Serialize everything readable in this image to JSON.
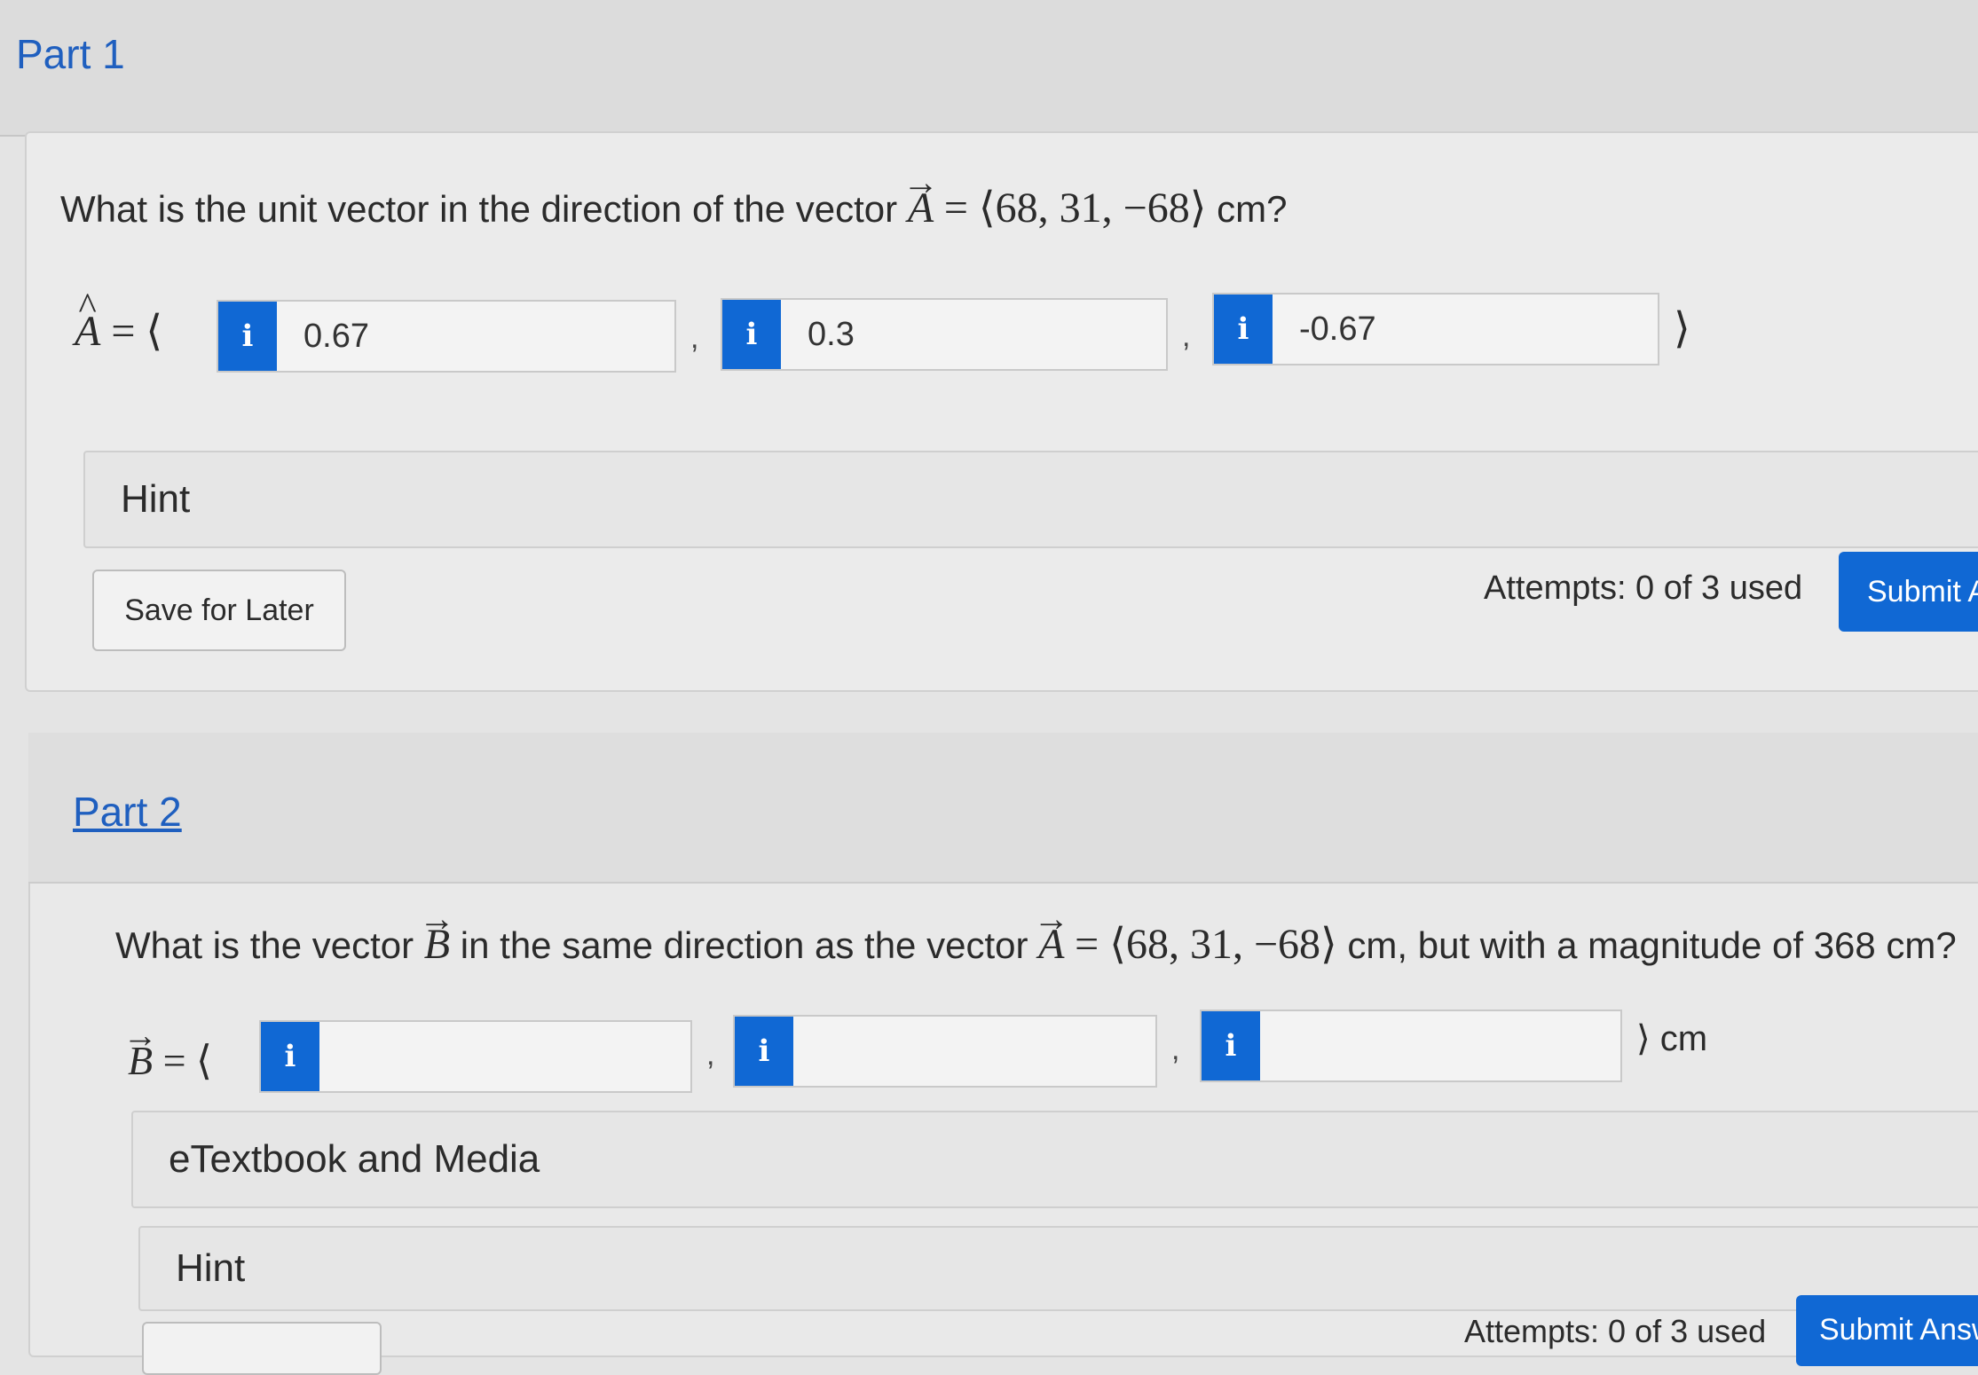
{
  "part1": {
    "title": "Part 1",
    "question_prefix": "What is the unit vector in the direction of the vector",
    "vector_symbol": "A",
    "vector_value": "⟨68,  31,  −68⟩",
    "unit_suffix": "cm?",
    "answer_label": "A",
    "answers": [
      "0.67",
      "0.3",
      "-0.67"
    ],
    "hint_label": "Hint",
    "save_label": "Save for Later",
    "attempts_label": "Attempts: 0 of 3 used",
    "submit_label": "Submit A"
  },
  "part2": {
    "title": "Part 2",
    "question_prefix": "What is the vector",
    "vector_b": "B",
    "question_mid": "in the same direction as the vector",
    "vector_a": "A",
    "vector_value": "⟨68,  31,  −68⟩",
    "question_suffix": "cm, but with a magnitude of 368 cm?",
    "answer_label": "B",
    "answers": [
      "",
      "",
      ""
    ],
    "unit": "⟩ cm",
    "etextbook_label": "eTextbook and Media",
    "hint_label": "Hint",
    "attempts_label": "Attempts: 0 of 3 used",
    "submit_label": "Submit Answ"
  },
  "icons": {
    "info": "i",
    "cursor": "mouse-pointer"
  },
  "colors": {
    "accent": "#1068d4",
    "link": "#1f5fbf"
  }
}
